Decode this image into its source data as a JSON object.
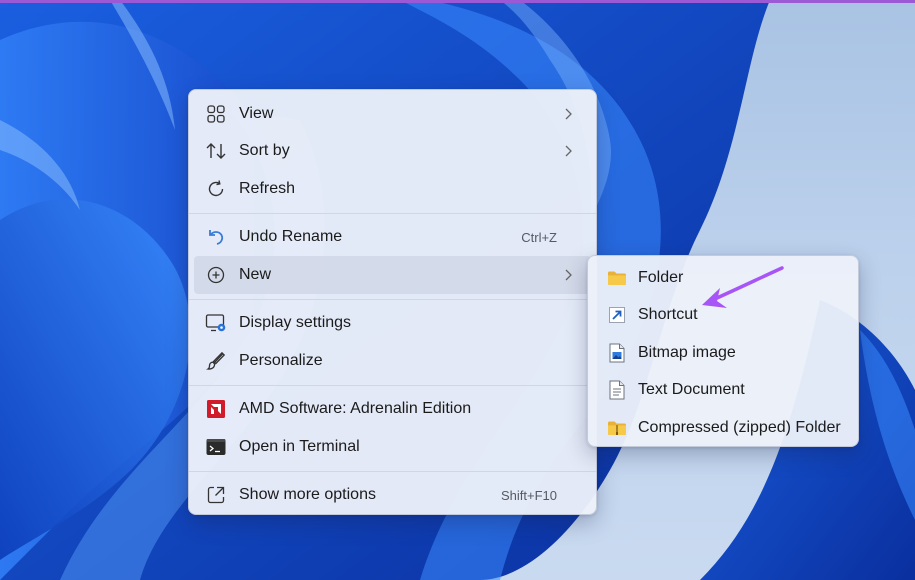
{
  "desktop": {
    "wallpaper": "Windows 11 bloom wallpaper (blue)",
    "accent_color": "#9b59d6"
  },
  "context_menu": {
    "items": [
      {
        "label": "View",
        "icon": "grid-icon",
        "submenu": true
      },
      {
        "label": "Sort by",
        "icon": "sort-arrows-icon",
        "submenu": true
      },
      {
        "label": "Refresh",
        "icon": "refresh-icon"
      },
      {
        "label": "Undo Rename",
        "icon": "undo-icon",
        "shortcut": "Ctrl+Z"
      },
      {
        "label": "New",
        "icon": "plus-circle-icon",
        "submenu": true,
        "highlighted": true
      },
      {
        "label": "Display settings",
        "icon": "display-settings-icon"
      },
      {
        "label": "Personalize",
        "icon": "brush-icon"
      },
      {
        "label": "AMD Software: Adrenalin Edition",
        "icon": "amd-logo-icon"
      },
      {
        "label": "Open in Terminal",
        "icon": "terminal-icon"
      },
      {
        "label": "Show more options",
        "icon": "more-options-icon",
        "shortcut": "Shift+F10"
      }
    ]
  },
  "new_submenu": {
    "items": [
      {
        "label": "Folder",
        "icon": "folder-icon"
      },
      {
        "label": "Shortcut",
        "icon": "shortcut-arrow-icon"
      },
      {
        "label": "Bitmap image",
        "icon": "bitmap-icon"
      },
      {
        "label": "Text Document",
        "icon": "text-document-icon"
      },
      {
        "label": "Compressed (zipped) Folder",
        "icon": "zip-folder-icon"
      }
    ]
  },
  "annotation": {
    "arrow_color": "#a855f7",
    "points_to": "Shortcut"
  }
}
